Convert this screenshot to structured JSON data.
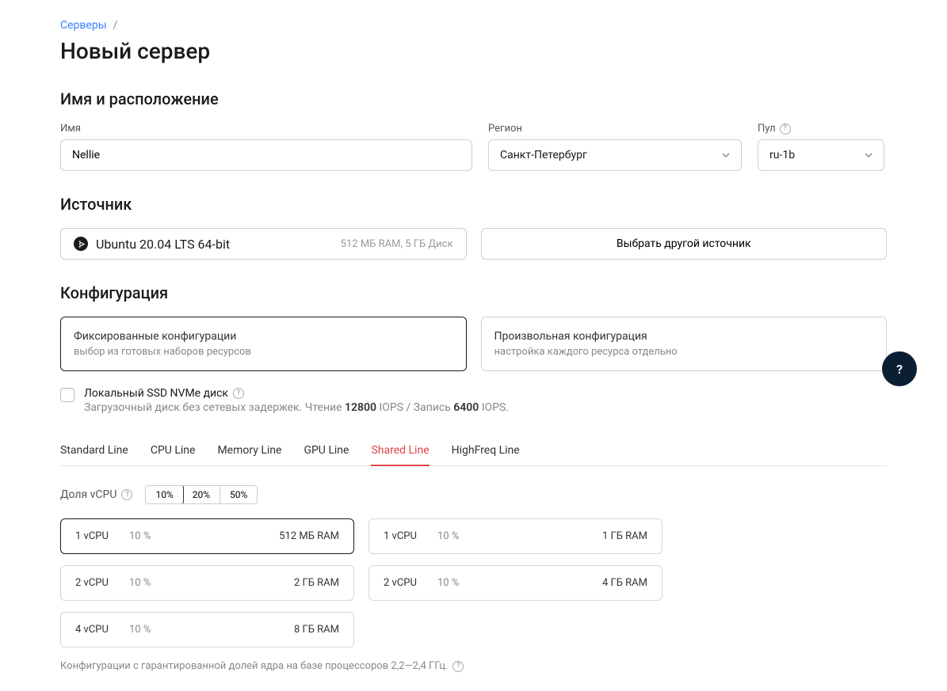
{
  "breadcrumb": {
    "link": "Серверы",
    "sep": "/"
  },
  "page_title": "Новый сервер",
  "section_name_loc": "Имя и расположение",
  "fields": {
    "name": {
      "label": "Имя",
      "value": "Nellie"
    },
    "region": {
      "label": "Регион",
      "value": "Санкт-Петербург"
    },
    "pool": {
      "label": "Пул",
      "value": "ru-1b"
    }
  },
  "section_source": "Источник",
  "source": {
    "os": "Ubuntu 20.04 LTS 64-bit",
    "reqs": "512 МБ RAM, 5 ГБ Диск",
    "other_btn": "Выбрать другой источник"
  },
  "section_config": "Конфигурация",
  "config_cards": {
    "fixed": {
      "title": "Фиксированные конфигурации",
      "desc": "выбор из готовых наборов ресурсов"
    },
    "custom": {
      "title": "Произвольная конфигурация",
      "desc": "настройка каждого ресурса отдельно"
    }
  },
  "ssd": {
    "title": "Локальный SSD NVMe диск",
    "desc_prefix": "Загрузочный диск без сетевых задержек. Чтение ",
    "read_iops": "12800",
    "desc_mid": " IOPS / Запись ",
    "write_iops": "6400",
    "desc_suffix": " IOPS."
  },
  "tabs": [
    "Standard Line",
    "CPU Line",
    "Memory Line",
    "GPU Line",
    "Shared Line",
    "HighFreq Line"
  ],
  "active_tab": "Shared Line",
  "vcpu_share": {
    "label": "Доля vCPU",
    "options": [
      "10%",
      "20%",
      "50%"
    ],
    "selected": "10%"
  },
  "plans": [
    {
      "cpu": "1 vCPU",
      "pct": "10 %",
      "ram": "512 МБ RAM",
      "selected": true
    },
    {
      "cpu": "1 vCPU",
      "pct": "10 %",
      "ram": "1 ГБ RAM",
      "selected": false
    },
    {
      "cpu": "2 vCPU",
      "pct": "10 %",
      "ram": "2 ГБ RAM",
      "selected": false
    },
    {
      "cpu": "2 vCPU",
      "pct": "10 %",
      "ram": "4 ГБ RAM",
      "selected": false
    },
    {
      "cpu": "4 vCPU",
      "pct": "10 %",
      "ram": "8 ГБ RAM",
      "selected": false
    }
  ],
  "footnote": "Конфигурации с гарантированной долей ядра на базе процессоров 2,2—2,4 ГГц.",
  "help": "?"
}
